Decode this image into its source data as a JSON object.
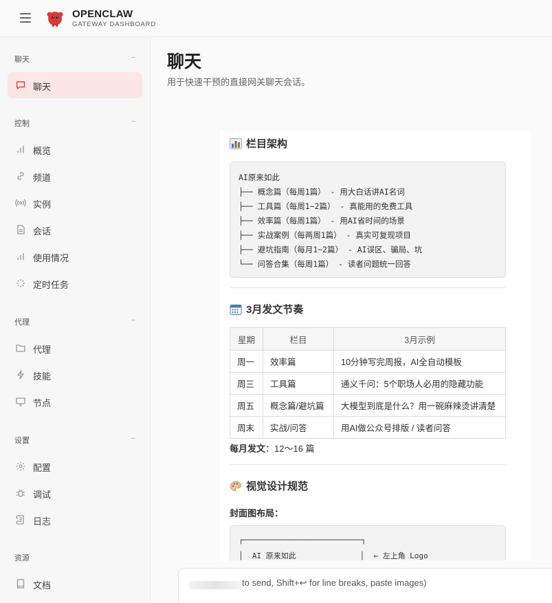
{
  "header": {
    "title": "OPENCLAW",
    "subtitle": "GATEWAY DASHBOARD"
  },
  "sidebar": {
    "sections": [
      {
        "title": "聊天",
        "collapse": "−",
        "items": [
          {
            "label": "聊天",
            "icon": "chat-bubble-icon",
            "active": true
          }
        ]
      },
      {
        "title": "控制",
        "collapse": "−",
        "items": [
          {
            "label": "概览",
            "icon": "bar-chart-icon"
          },
          {
            "label": "频道",
            "icon": "link-icon"
          },
          {
            "label": "实例",
            "icon": "broadcast-icon"
          },
          {
            "label": "会话",
            "icon": "document-icon"
          },
          {
            "label": "使用情况",
            "icon": "bar-chart-icon"
          },
          {
            "label": "定时任务",
            "icon": "loader-icon"
          }
        ]
      },
      {
        "title": "代理",
        "collapse": "−",
        "items": [
          {
            "label": "代理",
            "icon": "folder-icon"
          },
          {
            "label": "技能",
            "icon": "lightning-icon"
          },
          {
            "label": "节点",
            "icon": "monitor-icon"
          }
        ]
      },
      {
        "title": "设置",
        "collapse": "−",
        "items": [
          {
            "label": "配置",
            "icon": "gear-icon"
          },
          {
            "label": "调试",
            "icon": "bug-icon"
          },
          {
            "label": "日志",
            "icon": "scroll-icon"
          }
        ]
      },
      {
        "title": "资源",
        "collapse": "",
        "items": [
          {
            "label": "文档",
            "icon": "book-icon"
          }
        ]
      }
    ]
  },
  "main": {
    "title": "聊天",
    "subtitle": "用于快速干预的直接网关聊天会话。"
  },
  "message": {
    "section1": {
      "title": "栏目架构",
      "lines": [
        "AI原来如此",
        "├── 概念篇（每周1篇） - 用大白话讲AI名词",
        "├── 工具篇（每周1~2篇） - 真能用的免费工具",
        "├── 效率篇（每周1篇） - 用AI省时间的场景",
        "├── 实战案例（每两周1篇） - 真实可复现项目",
        "├── 避坑指南（每月1~2篇） - AI误区、骗局、坑",
        "└── 问答合集（每周1篇） - 读者问题统一回答"
      ]
    },
    "section2": {
      "title": "3月发文节奏",
      "headers": [
        "星期",
        "栏目",
        "3月示例"
      ],
      "rows": [
        [
          "周一",
          "效率篇",
          "10分钟写完周报，AI全自动模板"
        ],
        [
          "周三",
          "工具篇",
          "通义千问：5个职场人必用的隐藏功能"
        ],
        [
          "周五",
          "概念篇/避坑篇",
          "大模型到底是什么？用一碗麻辣烫讲清楚"
        ],
        [
          "周末",
          "实战/问答",
          "用AI做公众号排版 / 读者问答"
        ]
      ],
      "monthly_label": "每月发文",
      "monthly_value": "：12～16 篇"
    },
    "section3": {
      "title": "视觉设计规范",
      "cover_label": "封面图布局：",
      "cover_lines": [
        "┌──────────────────────────┐",
        "│  AI 原来如此              │  ← 左上角 Logo"
      ]
    }
  },
  "composer": {
    "placeholder": "to send, Shift+↩ for line breaks, paste images)"
  },
  "colors": {
    "accent": "#d94b4b",
    "active_bg": "#fbe5e5"
  }
}
